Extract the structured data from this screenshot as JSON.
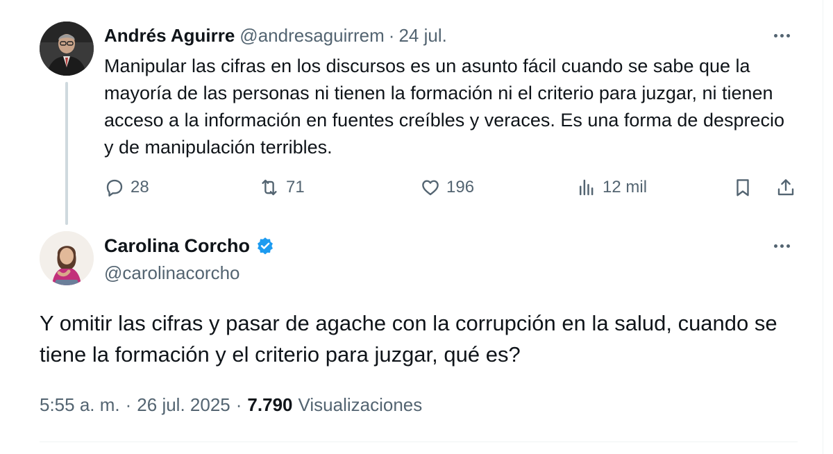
{
  "parent_tweet": {
    "name": "Andrés Aguirre",
    "handle": "@andresaguirrem",
    "separator": "·",
    "date": "24 jul.",
    "text": "Manipular las cifras en los discursos es un asunto fácil cuando se sabe que la mayoría de las personas ni tienen la formación ni el criterio para juzgar, ni tienen acceso a la información en fuentes creíbles y veraces. Es una forma de desprecio y de manipulación terribles.",
    "replies": "28",
    "reposts": "71",
    "likes": "196",
    "views": "12 mil",
    "icons": [
      "avatar",
      "more-icon",
      "reply-icon",
      "repost-icon",
      "like-icon",
      "views-icon",
      "bookmark-icon",
      "share-icon"
    ]
  },
  "main_tweet": {
    "name": "Carolina Corcho",
    "handle": "@carolinacorcho",
    "verified_color": "#1d9bf0",
    "text": "Y omitir las cifras y pasar de agache con la corrupción en la salud, cuando se tiene la formación y el criterio para juzgar, qué es?",
    "time": "5:55 a. m.",
    "separator1": "·",
    "date": "26 jul. 2025",
    "separator2": "·",
    "views_count": "7.790",
    "views_label": "Visualizaciones"
  },
  "colors": {
    "text_primary": "#0f1419",
    "text_secondary": "#536471",
    "thread_line": "#cfd9de",
    "divider": "#eff3f4"
  }
}
